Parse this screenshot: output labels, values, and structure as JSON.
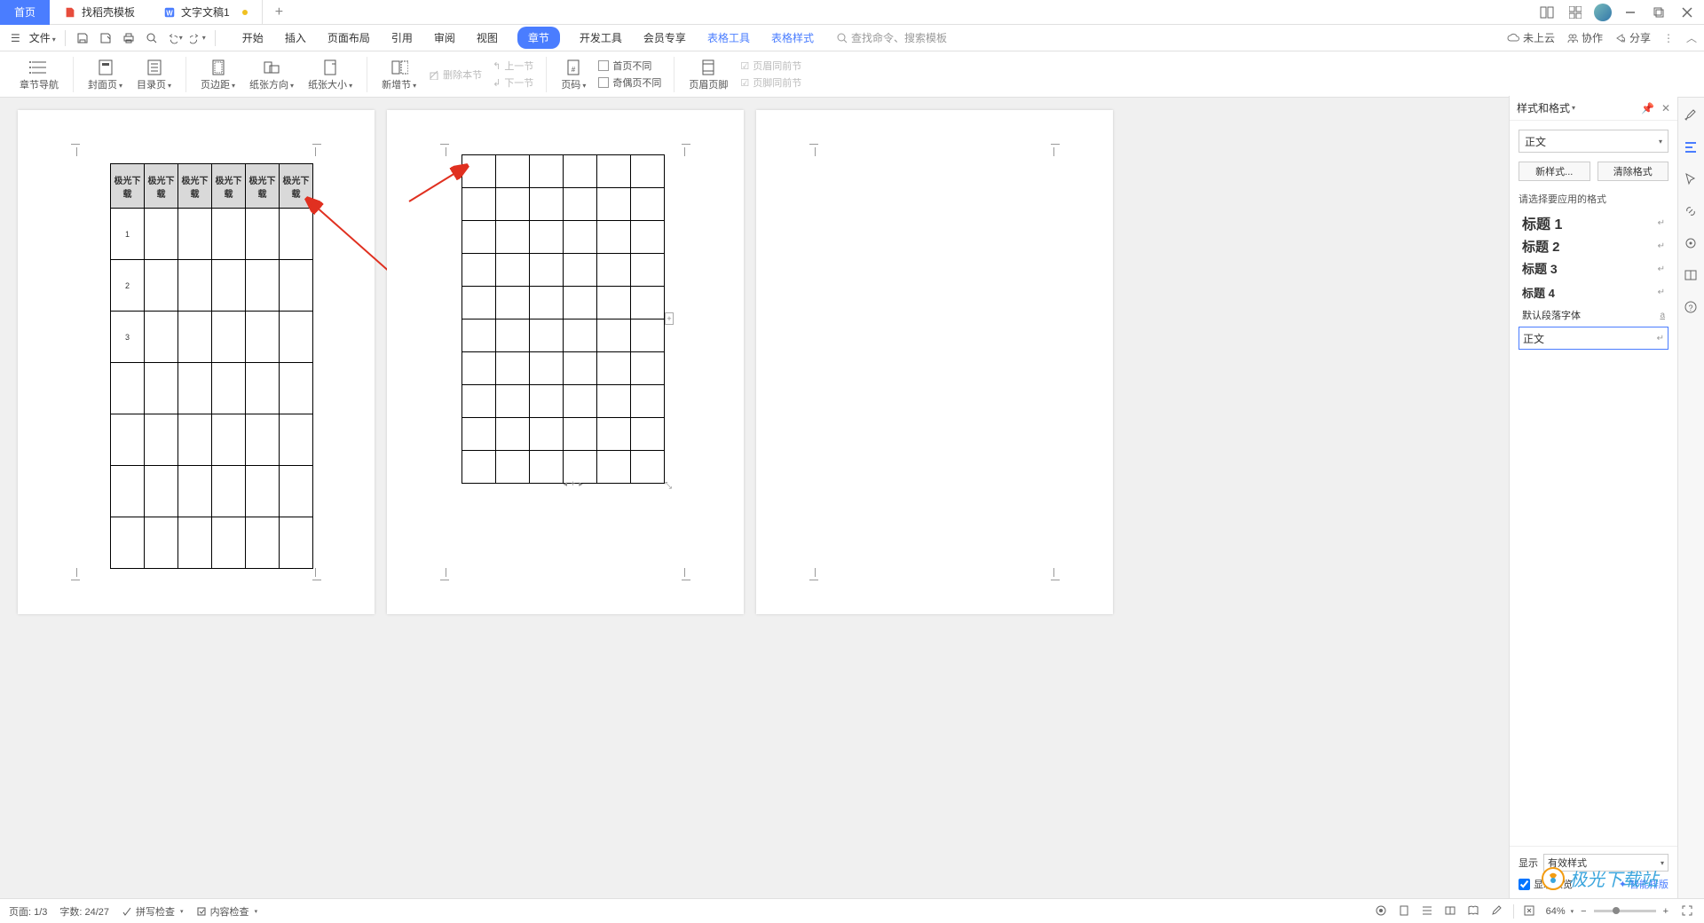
{
  "tabs": {
    "home": "首页",
    "template": "找稻壳模板",
    "document": "文字文稿1"
  },
  "menubar": {
    "file": "文件",
    "items": [
      "开始",
      "插入",
      "页面布局",
      "引用",
      "审阅",
      "视图",
      "章节",
      "开发工具",
      "会员专享",
      "表格工具",
      "表格样式"
    ],
    "active_index": 6,
    "blue_indices": [
      9,
      10
    ],
    "search_placeholder": "查找命令、搜索模板"
  },
  "menubar_right": {
    "cloud": "未上云",
    "collab": "协作",
    "share": "分享"
  },
  "ribbon": {
    "chapter_nav": "章节导航",
    "cover": "封面页",
    "toc": "目录页",
    "margin": "页边距",
    "orientation": "纸张方向",
    "size": "纸张大小",
    "new_section": "新增节",
    "delete_section": "删除本节",
    "prev_section": "上一节",
    "next_section": "下一节",
    "page_number": "页码",
    "first_diff": "首页不同",
    "odd_even_diff": "奇偶页不同",
    "header_footer": "页眉页脚",
    "header_link_prev": "页眉同前节",
    "footer_link_prev": "页脚同前节"
  },
  "table_header_cell": "极光下载",
  "table1_rows": [
    "1",
    "",
    "2",
    "",
    "3",
    "",
    ""
  ],
  "style_panel": {
    "title": "样式和格式",
    "current_style": "正文",
    "new_style": "新样式...",
    "clear_format": "清除格式",
    "apply_label": "请选择要应用的格式",
    "headings": [
      "标题 1",
      "标题 2",
      "标题 3",
      "标题 4"
    ],
    "default_font": "默认段落字体",
    "normal": "正文",
    "show_label": "显示",
    "show_value": "有效样式",
    "preview_label": "显示预览",
    "smart_typeset": "智能排版"
  },
  "statusbar": {
    "page": "页面: 1/3",
    "words": "字数: 24/27",
    "spell": "拼写检查",
    "content": "内容检查",
    "zoom": "64%"
  },
  "watermark": "极光下载站"
}
